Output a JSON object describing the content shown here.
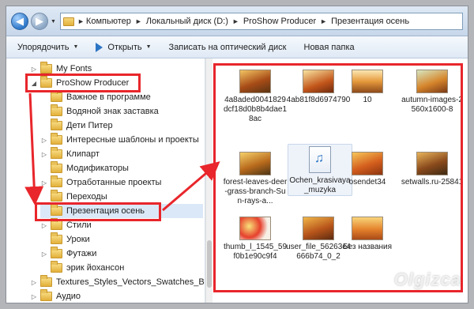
{
  "address": {
    "crumbs": [
      "Компьютер",
      "Локальный диск (D:)",
      "ProShow Producer",
      "Презентация осень"
    ]
  },
  "toolbar": {
    "organize": "Упорядочить",
    "open": "Открыть",
    "burn": "Записать на оптический диск",
    "new_folder": "Новая папка"
  },
  "tree": {
    "items": [
      {
        "label": "My Fonts",
        "expander": "▷"
      },
      {
        "label": "ProShow Producer",
        "expander": "◢"
      },
      {
        "label": "Важное в программе",
        "expander": ""
      },
      {
        "label": "Водяной знак заставка",
        "expander": ""
      },
      {
        "label": "Дети Питер",
        "expander": ""
      },
      {
        "label": "Интересные шаблоны и проекты",
        "expander": "▷"
      },
      {
        "label": "Клипарт",
        "expander": "▷"
      },
      {
        "label": "Модификаторы",
        "expander": ""
      },
      {
        "label": "Отработанные проекты",
        "expander": "▷"
      },
      {
        "label": "Переходы",
        "expander": ""
      },
      {
        "label": "Презентация осень",
        "expander": ""
      },
      {
        "label": "Стили",
        "expander": "▷"
      },
      {
        "label": "Уроки",
        "expander": ""
      },
      {
        "label": "Футажи",
        "expander": "▷"
      },
      {
        "label": "эрик йохансон",
        "expander": ""
      },
      {
        "label": "Textures_Styles_Vectors_Swatches_By_Im",
        "expander": "▷"
      },
      {
        "label": "Аудио",
        "expander": "▷"
      }
    ]
  },
  "files": [
    {
      "name": "4a8aded0041829dcf18d0b8b4dae18ac"
    },
    {
      "name": "4ab81f8d6974790"
    },
    {
      "name": "10"
    },
    {
      "name": "autumn-images-2560x1600-8"
    },
    {
      "name": "forest-leaves-deer-grass-branch-Sun-rays-a..."
    },
    {
      "name": "Ochen_krasivaya_muzyka"
    },
    {
      "name": "osendet34"
    },
    {
      "name": "setwalls.ru-25841"
    },
    {
      "name": "thumb_l_1545_59f0b1e90c9f4"
    },
    {
      "name": "user_file_56263c4666b74_0_2"
    },
    {
      "name": "Без названия"
    }
  ],
  "watermark": "Olgizca",
  "colors": {
    "highlight": "#e8262b",
    "accent": "#2c74c4"
  }
}
